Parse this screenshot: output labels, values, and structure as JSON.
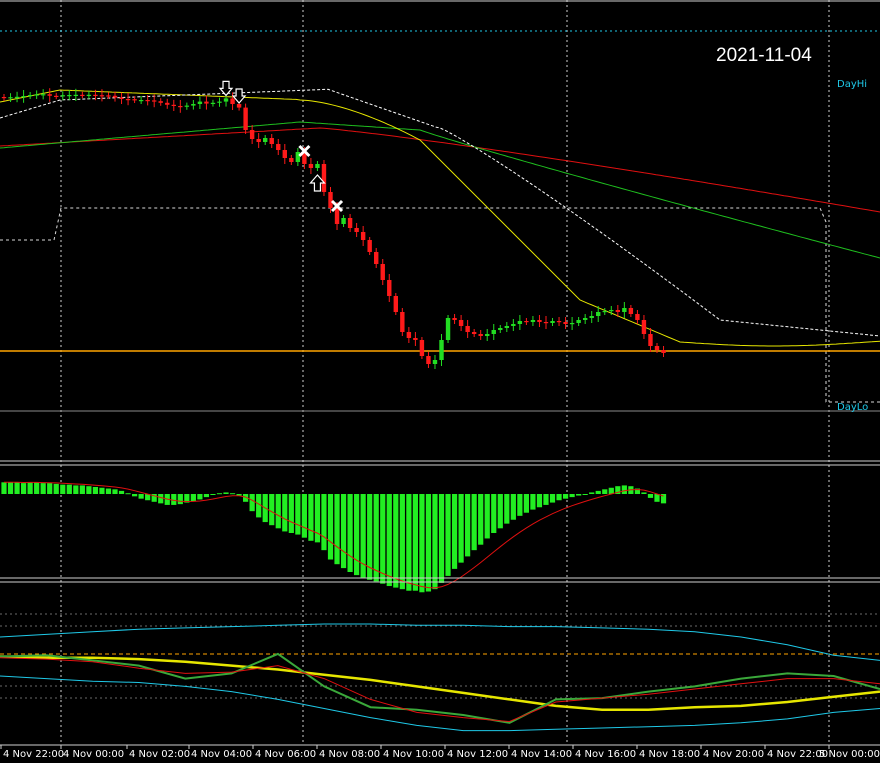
{
  "header": {
    "date": "2021-11-04"
  },
  "levels": {
    "day_high_label": "DayHi",
    "day_low_label": "DayLo"
  },
  "colors": {
    "background": "#000000",
    "bull_candle": "#22dd22",
    "bear_candle": "#ff1a1a",
    "histogram": "#22ee22",
    "red_line": "#e01010",
    "green_line": "#1fbf1f",
    "ma_yellow": "#e6e600",
    "ma_dashed": "#ffffff",
    "horizontal_orange": "#ffa500",
    "cyan": "#1fc9e8",
    "separator": "#d0d0d0"
  },
  "icons": {
    "sell_arrow": "down-arrow-icon",
    "buy_arrow": "up-arrow-icon",
    "exit_marker": "cross-icon"
  },
  "x_axis": {
    "labels": [
      "4 Nov 22:00",
      "4 Nov 00:00",
      "4 Nov 02:00",
      "4 Nov 04:00",
      "4 Nov 06:00",
      "4 Nov 08:00",
      "4 Nov 10:00",
      "4 Nov 12:00",
      "4 Nov 14:00",
      "4 Nov 16:00",
      "4 Nov 18:00",
      "4 Nov 20:00",
      "4 Nov 22:00",
      "5 Nov 00:00"
    ]
  },
  "chart_data": [
    {
      "type": "candlestick",
      "title": "2021-11-04",
      "xlabel": "",
      "ylabel": "",
      "candles_close_relative": [
        0.03,
        0.034,
        0.036,
        0.04,
        0.045,
        0.048,
        0.049,
        0.041,
        0.039,
        0.044,
        0.045,
        0.046,
        0.044,
        0.046,
        0.044,
        0.043,
        0.041,
        0.032,
        0.025,
        0.024,
        0.02,
        0.02,
        0.018,
        0.014,
        0.006,
        -0.004,
        -0.01,
        -0.014,
        -0.008,
        0.0,
        0.012,
        0.002,
        0.006,
        0.012,
        0.028,
        0.0,
        -0.018,
        -0.13,
        -0.175,
        -0.19,
        -0.17,
        -0.2,
        -0.23,
        -0.27,
        -0.29,
        -0.24,
        -0.3,
        -0.32,
        -0.3,
        -0.44,
        -0.52,
        -0.6,
        -0.57,
        -0.62,
        -0.64,
        -0.68,
        -0.74,
        -0.8,
        -0.88,
        -0.96,
        -1.04,
        -1.14,
        -1.17,
        -1.18,
        -1.26,
        -1.3,
        -1.28,
        -1.18,
        -1.07,
        -1.08,
        -1.11,
        -1.14,
        -1.15,
        -1.16,
        -1.15,
        -1.13,
        -1.12,
        -1.11,
        -1.1,
        -1.085,
        -1.09,
        -1.08,
        -1.09,
        -1.095,
        -1.085,
        -1.09,
        -1.1,
        -1.095,
        -1.08,
        -1.07,
        -1.06,
        -1.04,
        -1.035,
        -1.03,
        -1.04,
        -1.02,
        -1.05,
        -1.08,
        -1.15,
        -1.21,
        -1.23,
        -1.245
      ],
      "signals": [
        {
          "type": "sell",
          "candle": 34
        },
        {
          "type": "sell",
          "candle": 36
        },
        {
          "type": "exit",
          "candle": 46
        },
        {
          "type": "buy",
          "candle": 48
        },
        {
          "type": "exit",
          "candle": 51
        }
      ],
      "overlay_lines": [
        "red MA",
        "green MA",
        "yellow MA",
        "dashed white band"
      ],
      "horizontal_levels": [
        "DayHi",
        "DayLo",
        "orange level"
      ]
    },
    {
      "type": "bar",
      "title": "",
      "description_series": "oscillator histogram with red signal line",
      "histogram": [
        0.15,
        0.15,
        0.15,
        0.14,
        0.15,
        0.15,
        0.14,
        0.14,
        0.13,
        0.12,
        0.12,
        0.11,
        0.11,
        0.1,
        0.09,
        0.08,
        0.07,
        0.06,
        0.04,
        0.01,
        -0.03,
        -0.06,
        -0.08,
        -0.1,
        -0.12,
        -0.14,
        -0.14,
        -0.13,
        -0.11,
        -0.09,
        -0.07,
        -0.04,
        -0.01,
        0.01,
        0.02,
        0.01,
        -0.02,
        -0.1,
        -0.22,
        -0.3,
        -0.36,
        -0.4,
        -0.44,
        -0.48,
        -0.5,
        -0.52,
        -0.56,
        -0.6,
        -0.62,
        -0.72,
        -0.84,
        -0.9,
        -0.95,
        -1.0,
        -1.04,
        -1.07,
        -1.1,
        -1.12,
        -1.15,
        -1.18,
        -1.2,
        -1.22,
        -1.24,
        -1.24,
        -1.26,
        -1.25,
        -1.22,
        -1.14,
        -1.05,
        -0.96,
        -0.88,
        -0.8,
        -0.72,
        -0.65,
        -0.57,
        -0.5,
        -0.44,
        -0.38,
        -0.33,
        -0.28,
        -0.24,
        -0.2,
        -0.17,
        -0.14,
        -0.11,
        -0.08,
        -0.06,
        -0.04,
        -0.02,
        0.0,
        0.02,
        0.04,
        0.06,
        0.08,
        0.1,
        0.11,
        0.1,
        0.07,
        0.02,
        -0.05,
        -0.1,
        -0.12
      ]
    },
    {
      "type": "line",
      "title": "",
      "series": [
        {
          "color": "cyan upper",
          "values": [
            0.3,
            0.28,
            0.26,
            0.24,
            0.23,
            0.22,
            0.21,
            0.2,
            0.2,
            0.21,
            0.21,
            0.22,
            0.22,
            0.23,
            0.24,
            0.26,
            0.3,
            0.36,
            0.44,
            0.48
          ]
        },
        {
          "color": "yellow",
          "values": [
            0.45,
            0.46,
            0.46,
            0.47,
            0.49,
            0.52,
            0.55,
            0.59,
            0.63,
            0.68,
            0.73,
            0.78,
            0.83,
            0.86,
            0.86,
            0.84,
            0.83,
            0.8,
            0.76,
            0.72
          ]
        },
        {
          "color": "cyan lower",
          "values": [
            0.6,
            0.62,
            0.64,
            0.65,
            0.68,
            0.72,
            0.78,
            0.85,
            0.92,
            0.98,
            1.02,
            1.02,
            1.01,
            1.0,
            0.99,
            0.98,
            0.96,
            0.93,
            0.88,
            0.85
          ]
        },
        {
          "color": "green",
          "values": [
            0.45,
            0.44,
            0.48,
            0.52,
            0.62,
            0.58,
            0.43,
            0.68,
            0.84,
            0.86,
            0.9,
            0.96,
            0.78,
            0.77,
            0.72,
            0.68,
            0.62,
            0.58,
            0.6,
            0.7
          ]
        },
        {
          "color": "red",
          "values": [
            0.46,
            0.47,
            0.49,
            0.54,
            0.58,
            0.57,
            0.52,
            0.62,
            0.78,
            0.88,
            0.92,
            0.95,
            0.8,
            0.77,
            0.74,
            0.7,
            0.66,
            0.62,
            0.62,
            0.66
          ]
        }
      ]
    }
  ]
}
